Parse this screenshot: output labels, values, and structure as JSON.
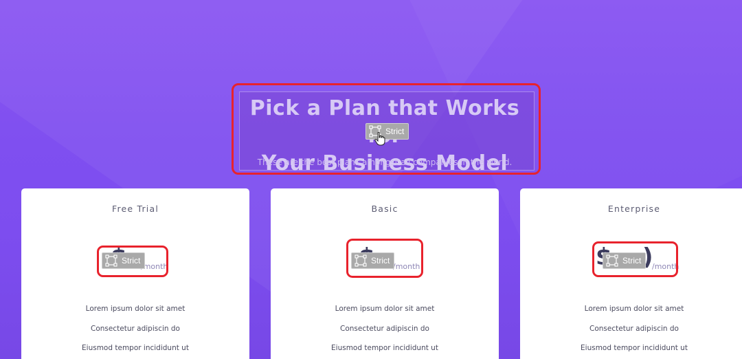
{
  "hero": {
    "title_line1": "Pick a Plan that Works for",
    "title_line2": "Your Business Model",
    "subtitle": "These are the best plans amongst all companies in the world."
  },
  "badge": {
    "label": "Strict",
    "icon": "transform-selection-icon"
  },
  "plans": [
    {
      "name": "Free Trial",
      "price_fragment": "$",
      "per": "/month",
      "features": [
        "Lorem ipsum dolor sit amet",
        "Consectetur adipiscin do",
        "Eiusmod tempor incididunt ut"
      ]
    },
    {
      "name": "Basic",
      "price_fragment": "$",
      "per": "/month",
      "features": [
        "Lorem ipsum dolor sit amet",
        "Consectetur adipiscin do",
        "Eiusmod tempor incididunt ut"
      ]
    },
    {
      "name": "Enterprise",
      "price_fragment": "$",
      "price_end": ")",
      "per": "/month",
      "features": [
        "Lorem ipsum dolor sit amet",
        "Consectetur adipiscin do",
        "Eiusmod tempor incididunt ut"
      ]
    }
  ],
  "colors": {
    "highlight_outline": "#e8222c",
    "background_purple": "#7f4ff0",
    "badge_gray": "#a9a9a9"
  }
}
